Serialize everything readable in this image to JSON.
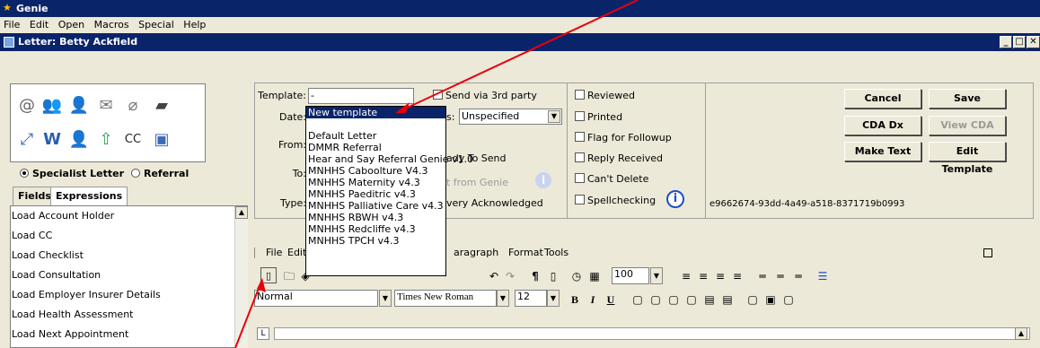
{
  "app": {
    "title": "Genie"
  },
  "menu": [
    "File",
    "Edit",
    "Open",
    "Macros",
    "Special",
    "Help"
  ],
  "window": {
    "title": "Letter: Betty Ackfield"
  },
  "letter_type": {
    "specialist": "Specialist Letter",
    "referral": "Referral",
    "selected": "Specialist Letter"
  },
  "tabs": [
    "Fields",
    "Expressions"
  ],
  "fields_list": [
    "Load Account Holder",
    "Load CC",
    "Load Checklist",
    "Load Consultation",
    "Load Employer Insurer Details",
    "Load Health Assessment",
    "Load Next Appointment"
  ],
  "form": {
    "template_label": "Template:",
    "template_value": "-",
    "date_label": "Date:",
    "from_label": "From:",
    "to_label": "To:",
    "type_label": "Type:",
    "send_3rd_party": "Send via 3rd party",
    "status_label_tail": "s:",
    "status_value": "Unspecified",
    "ready_to_send": "ady To Send",
    "sent_from_genie": "t from Genie",
    "delivery_ack": "very Acknowledged"
  },
  "checks": {
    "reviewed": "Reviewed",
    "printed": "Printed",
    "flag": "Flag for Followup",
    "reply": "Reply Received",
    "cant_delete": "Can't Delete",
    "spellcheck": "Spellchecking"
  },
  "guid": "e9662674-93dd-4a49-a518-8371719b0993",
  "buttons": {
    "cancel": "Cancel",
    "save": "Save",
    "cda_dx": "CDA Dx",
    "view_cda": "View CDA",
    "make_text": "Make Text",
    "edit_template": "Edit Template"
  },
  "template_options": [
    "New template",
    "",
    "Default Letter",
    "DMMR Referral",
    "Hear and Say Referral Genie v1.0",
    "MNHHS Caboolture V4.3",
    "MNHHS Maternity v4.3",
    "MNHHS Paeditric v4.3",
    "MNHHS Palliative Care v4.3",
    "MNHHS RBWH v4.3",
    "MNHHS Redcliffe v4.3",
    "MNHHS TPCH v4.3"
  ],
  "editor": {
    "menu": [
      "File",
      "Edit"
    ],
    "menu_tail": [
      "aragraph",
      "Format",
      "Tools"
    ],
    "zoom": "100",
    "style": "Normal",
    "font": "Times New Roman",
    "size": "12"
  },
  "annotation_color": "#e8000b"
}
